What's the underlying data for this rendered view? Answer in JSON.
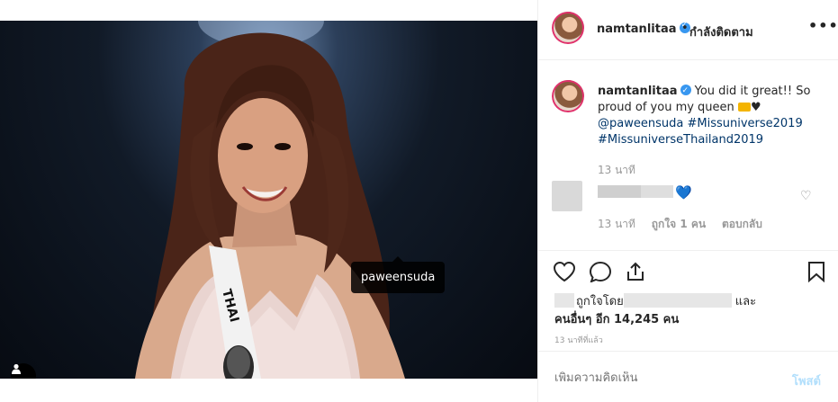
{
  "post": {
    "tag_label": "paweensuda",
    "sash_text": "THAI"
  },
  "header": {
    "username": "namtanlitaa",
    "separator": "•",
    "follow_label": "กำลังติดตาม",
    "more_label": "•••"
  },
  "caption": {
    "username": "namtanlitaa",
    "text": "You did it great!! So proud of you my queen",
    "emoji_heart": "♥",
    "mention": "@paweensuda",
    "hashtag1": "#Missuniverse2019",
    "hashtag2": "#MissuniverseThailand2019",
    "time": "13 นาที"
  },
  "comment": {
    "emoji": "💙",
    "time": "13 นาที",
    "likes": "ถูกใจ 1 คน",
    "reply": "ตอบกลับ"
  },
  "likes": {
    "prefix": "ถูกใจโดย",
    "and": "และ",
    "others": "คนอื่นๆ อีก 14,245 คน"
  },
  "timestamp": "13 นาทีที่แล้ว",
  "composer": {
    "placeholder": "เพิ่มความคิดเห็น",
    "post_label": "โพสต์"
  },
  "colors": {
    "accent": "#3897f0",
    "link": "#003569",
    "muted": "#999999",
    "post_disabled": "#b2dffc"
  }
}
